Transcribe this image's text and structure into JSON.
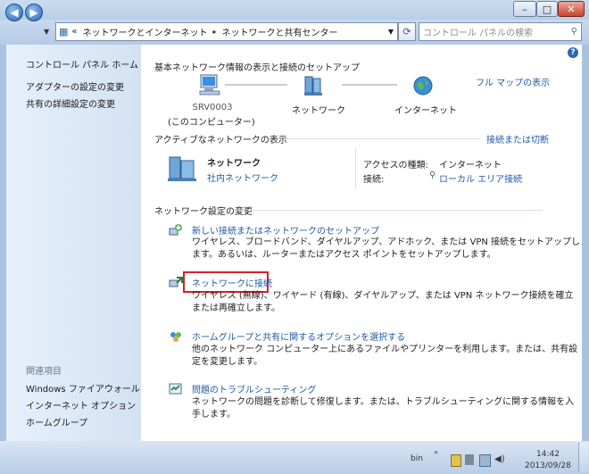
{
  "window": {
    "controls": {
      "minimize": "–",
      "maximize": "□",
      "close": "✕"
    }
  },
  "nav": {
    "back_icon": "back-arrow-icon",
    "forward_icon": "forward-arrow-icon",
    "breadcrumb_prefix": "«",
    "breadcrumb": [
      "ネットワークとインターネット",
      "ネットワークと共有センター"
    ],
    "search_placeholder": "コントロール パネルの検索"
  },
  "left": {
    "home": "コントロール パネル ホーム",
    "links": [
      "アダプターの設定の変更",
      "共有の詳細設定の変更"
    ],
    "related_heading": "関連項目",
    "related": [
      "Windows ファイアウォール",
      "インターネット オプション",
      "ホームグループ"
    ]
  },
  "main": {
    "heading": "基本ネットワーク情報の表示と接続のセットアップ",
    "full_map": "フル マップの表示",
    "map": {
      "computer_name": "SRV0003",
      "computer_sub": "(このコンピューター)",
      "network": "ネットワーク",
      "internet": "インターネット"
    },
    "active_heading": "アクティブなネットワークの表示",
    "connect_disconnect": "接続または切断",
    "active": {
      "name": "ネットワーク",
      "type": "社内ネットワーク",
      "access_label": "アクセスの種類:",
      "access_value": "インターネット",
      "conn_label": "接続:",
      "conn_value": "ローカル エリア接続"
    },
    "change_heading": "ネットワーク設定の変更",
    "tasks": [
      {
        "title": "新しい接続またはネットワークのセットアップ",
        "desc1": "ワイヤレス、ブロードバンド、ダイヤルアップ、アドホック、または VPN 接続をセットアップし",
        "desc2": "ます。あるいは、ルーターまたはアクセス ポイントをセットアップします。"
      },
      {
        "title": "ネットワークに接続",
        "desc1": "ワイヤレス (無線)、ワイヤード (有線)、ダイヤルアップ、または VPN ネットワーク接続を確立",
        "desc2": "または再確立します。"
      },
      {
        "title": "ホームグループと共有に関するオプションを選択する",
        "desc1": "他のネットワーク コンピューター上にあるファイルやプリンターを利用します。または、共有設",
        "desc2": "定を変更します。"
      },
      {
        "title": "問題のトラブルシューティング",
        "desc1": "ネットワークの問題を診断して修復します。または、トラブルシューティングに関する情報を入",
        "desc2": "手します。"
      }
    ]
  },
  "taskbar": {
    "user": "bin",
    "time": "14:42",
    "date": "2013/09/28"
  },
  "colors": {
    "link": "#1f59a8",
    "highlight_box": "#d4202a"
  }
}
